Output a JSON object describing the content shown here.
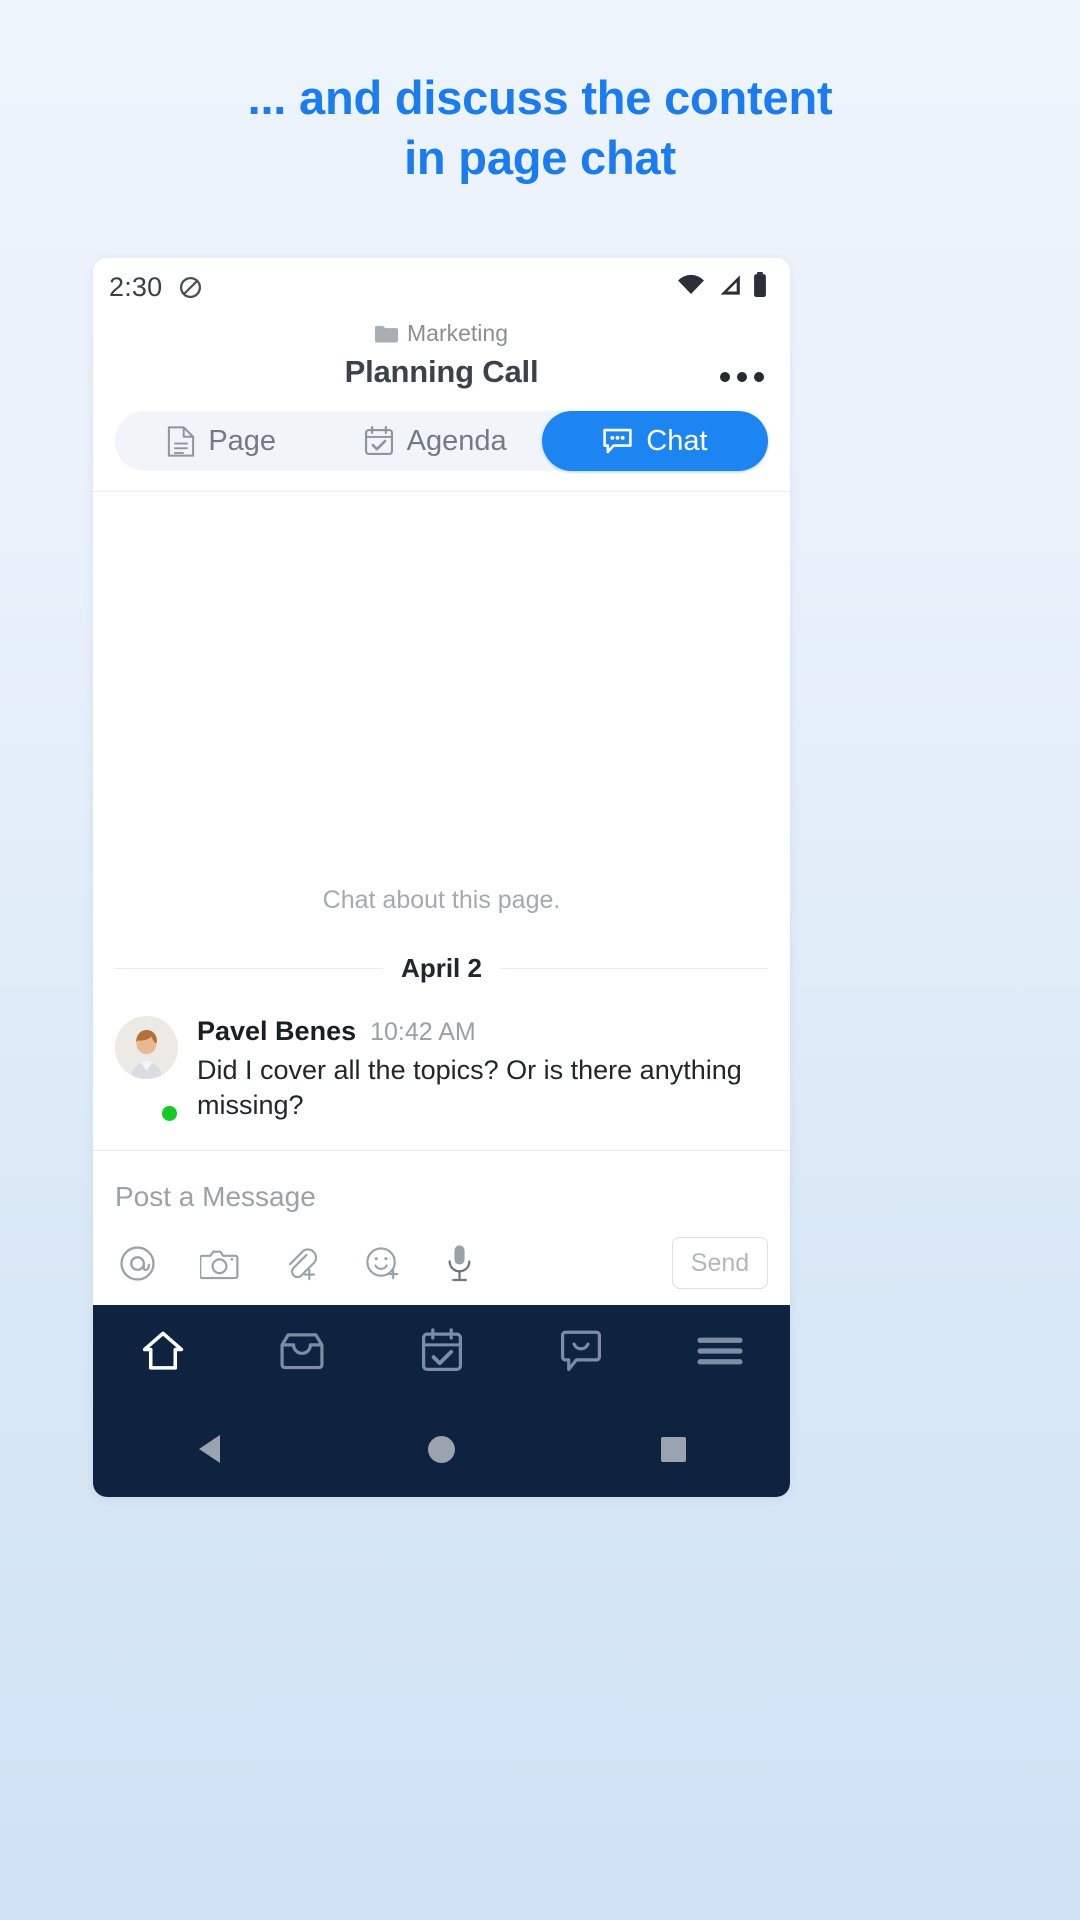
{
  "promo": {
    "line1": "... and discuss the content",
    "line2": "in page chat",
    "accent_color": "#1a7cf0"
  },
  "status_bar": {
    "time": "2:30",
    "dnd_icon": "do-not-disturb-icon",
    "wifi_icon": "wifi-icon",
    "signal_icon": "cell-signal-icon",
    "battery_icon": "battery-icon"
  },
  "header": {
    "breadcrumb_icon": "folder-icon",
    "breadcrumb": "Marketing",
    "title": "Planning Call",
    "more_label": "more-options"
  },
  "tabs": [
    {
      "label": "Page",
      "icon": "document-icon",
      "active": false
    },
    {
      "label": "Agenda",
      "icon": "calendar-check-icon",
      "active": false
    },
    {
      "label": "Chat",
      "icon": "chat-bubble-dots-icon",
      "active": true
    }
  ],
  "chat": {
    "empty_hint": "Chat about this page.",
    "date_divider": "April 2",
    "messages": [
      {
        "author": "Pavel Benes",
        "time": "10:42 AM",
        "text": "Did I cover all the topics? Or is there anything missing?",
        "presence": "online",
        "presence_color": "#11cc22"
      }
    ]
  },
  "composer": {
    "placeholder": "Post a Message",
    "send_label": "Send",
    "icons": [
      {
        "name": "mention-icon",
        "glyph": "@"
      },
      {
        "name": "camera-icon",
        "glyph": "camera"
      },
      {
        "name": "attachment-add-icon",
        "glyph": "paperclip-plus"
      },
      {
        "name": "emoji-add-icon",
        "glyph": "smiley-plus"
      },
      {
        "name": "microphone-icon",
        "glyph": "mic"
      }
    ]
  },
  "app_nav": [
    {
      "name": "home",
      "icon": "home-icon",
      "active": true
    },
    {
      "name": "inbox",
      "icon": "inbox-icon",
      "active": false
    },
    {
      "name": "agenda",
      "icon": "calendar-check-icon",
      "active": false
    },
    {
      "name": "chat",
      "icon": "chat-bubble-icon",
      "active": false
    },
    {
      "name": "menu",
      "icon": "hamburger-menu-icon",
      "active": false
    }
  ],
  "system_nav": [
    {
      "name": "back",
      "icon": "triangle-back-icon"
    },
    {
      "name": "home",
      "icon": "circle-home-icon"
    },
    {
      "name": "recents",
      "icon": "square-recents-icon"
    }
  ]
}
